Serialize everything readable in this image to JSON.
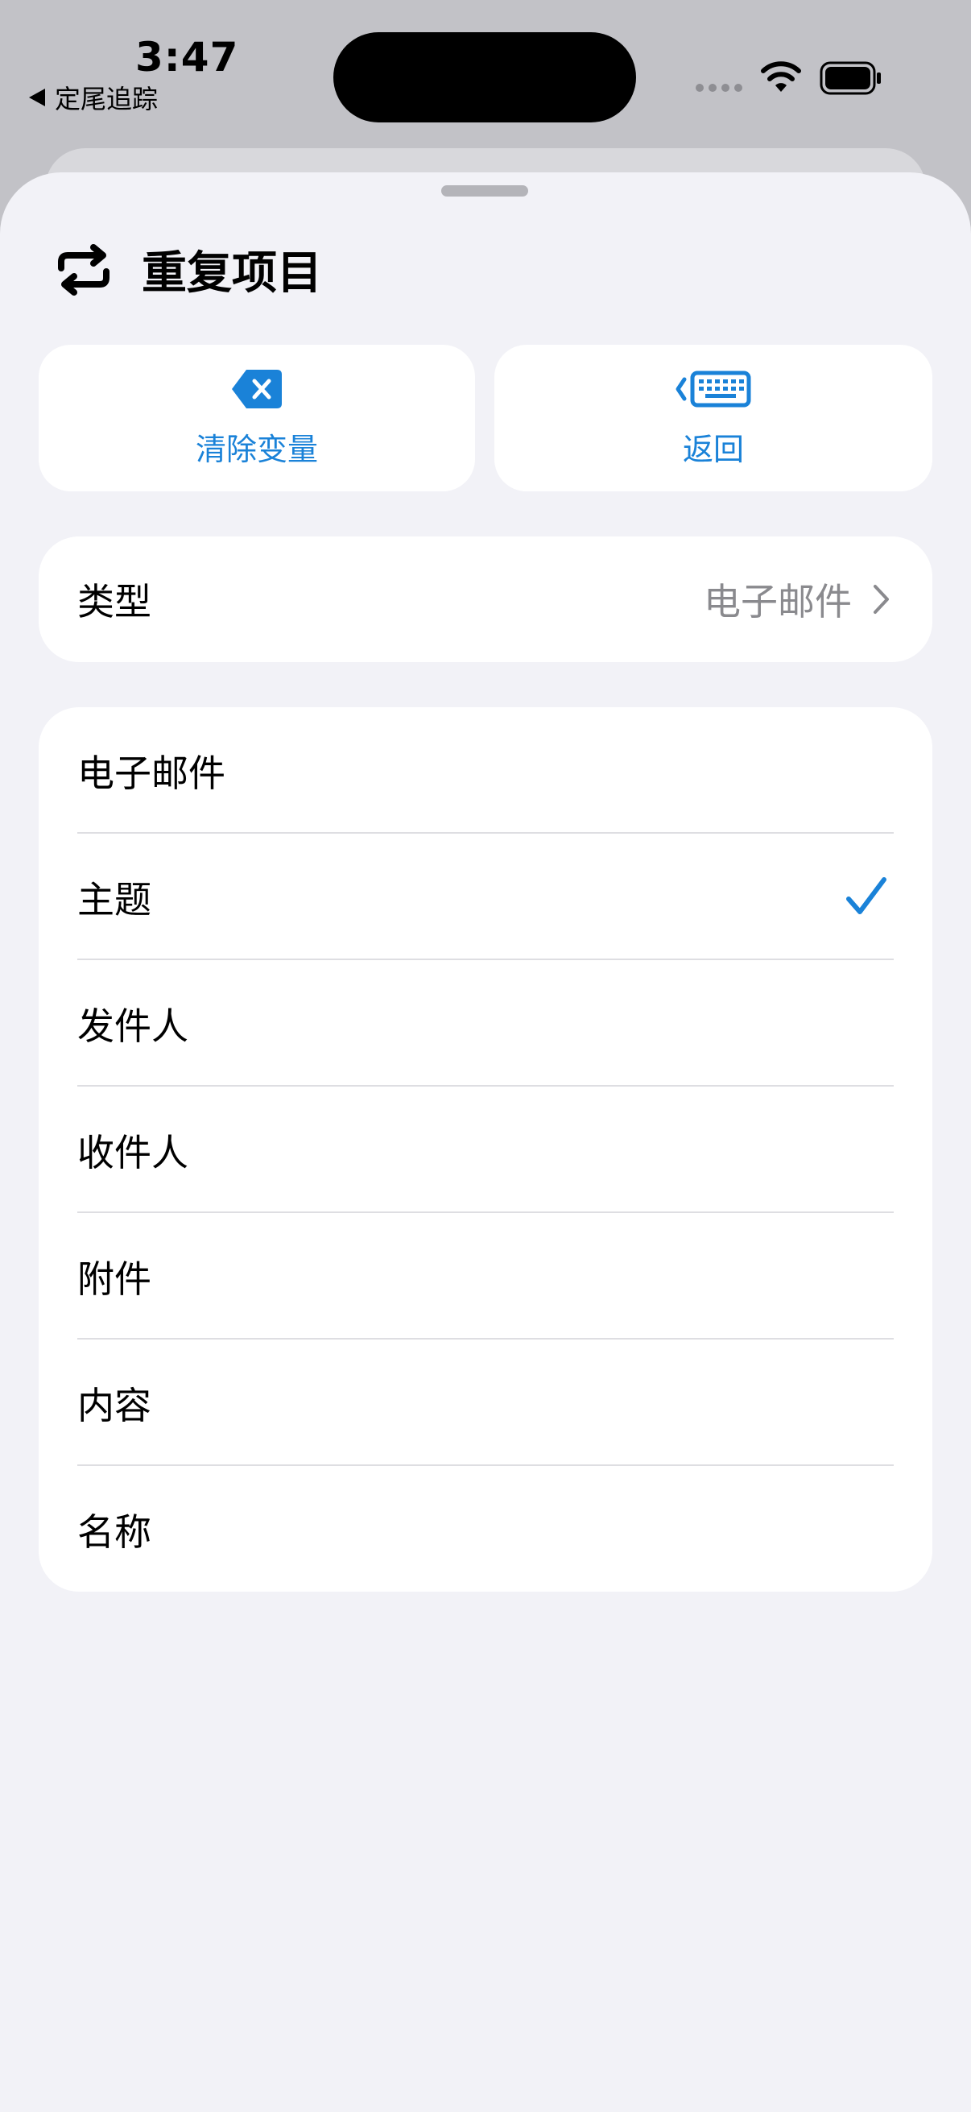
{
  "status_bar": {
    "time": "3:47",
    "back_app": "定尾追踪"
  },
  "sheet": {
    "title": "重复项目",
    "title_icon": "repeat-icon",
    "actions": [
      {
        "label": "清除变量",
        "icon": "delete-backward-icon"
      },
      {
        "label": "返回",
        "icon": "keyboard-back-icon"
      }
    ],
    "type_row": {
      "label": "类型",
      "value": "电子邮件"
    },
    "options": [
      {
        "label": "电子邮件",
        "selected": false
      },
      {
        "label": "主题",
        "selected": true
      },
      {
        "label": "发件人",
        "selected": false
      },
      {
        "label": "收件人",
        "selected": false
      },
      {
        "label": "附件",
        "selected": false
      },
      {
        "label": "内容",
        "selected": false
      },
      {
        "label": "名称",
        "selected": false
      }
    ]
  },
  "colors": {
    "accent": "#1a82d8",
    "sheet_background": "#f2f2f7",
    "card_background": "#ffffff",
    "secondary_text": "#8a8a8e"
  }
}
